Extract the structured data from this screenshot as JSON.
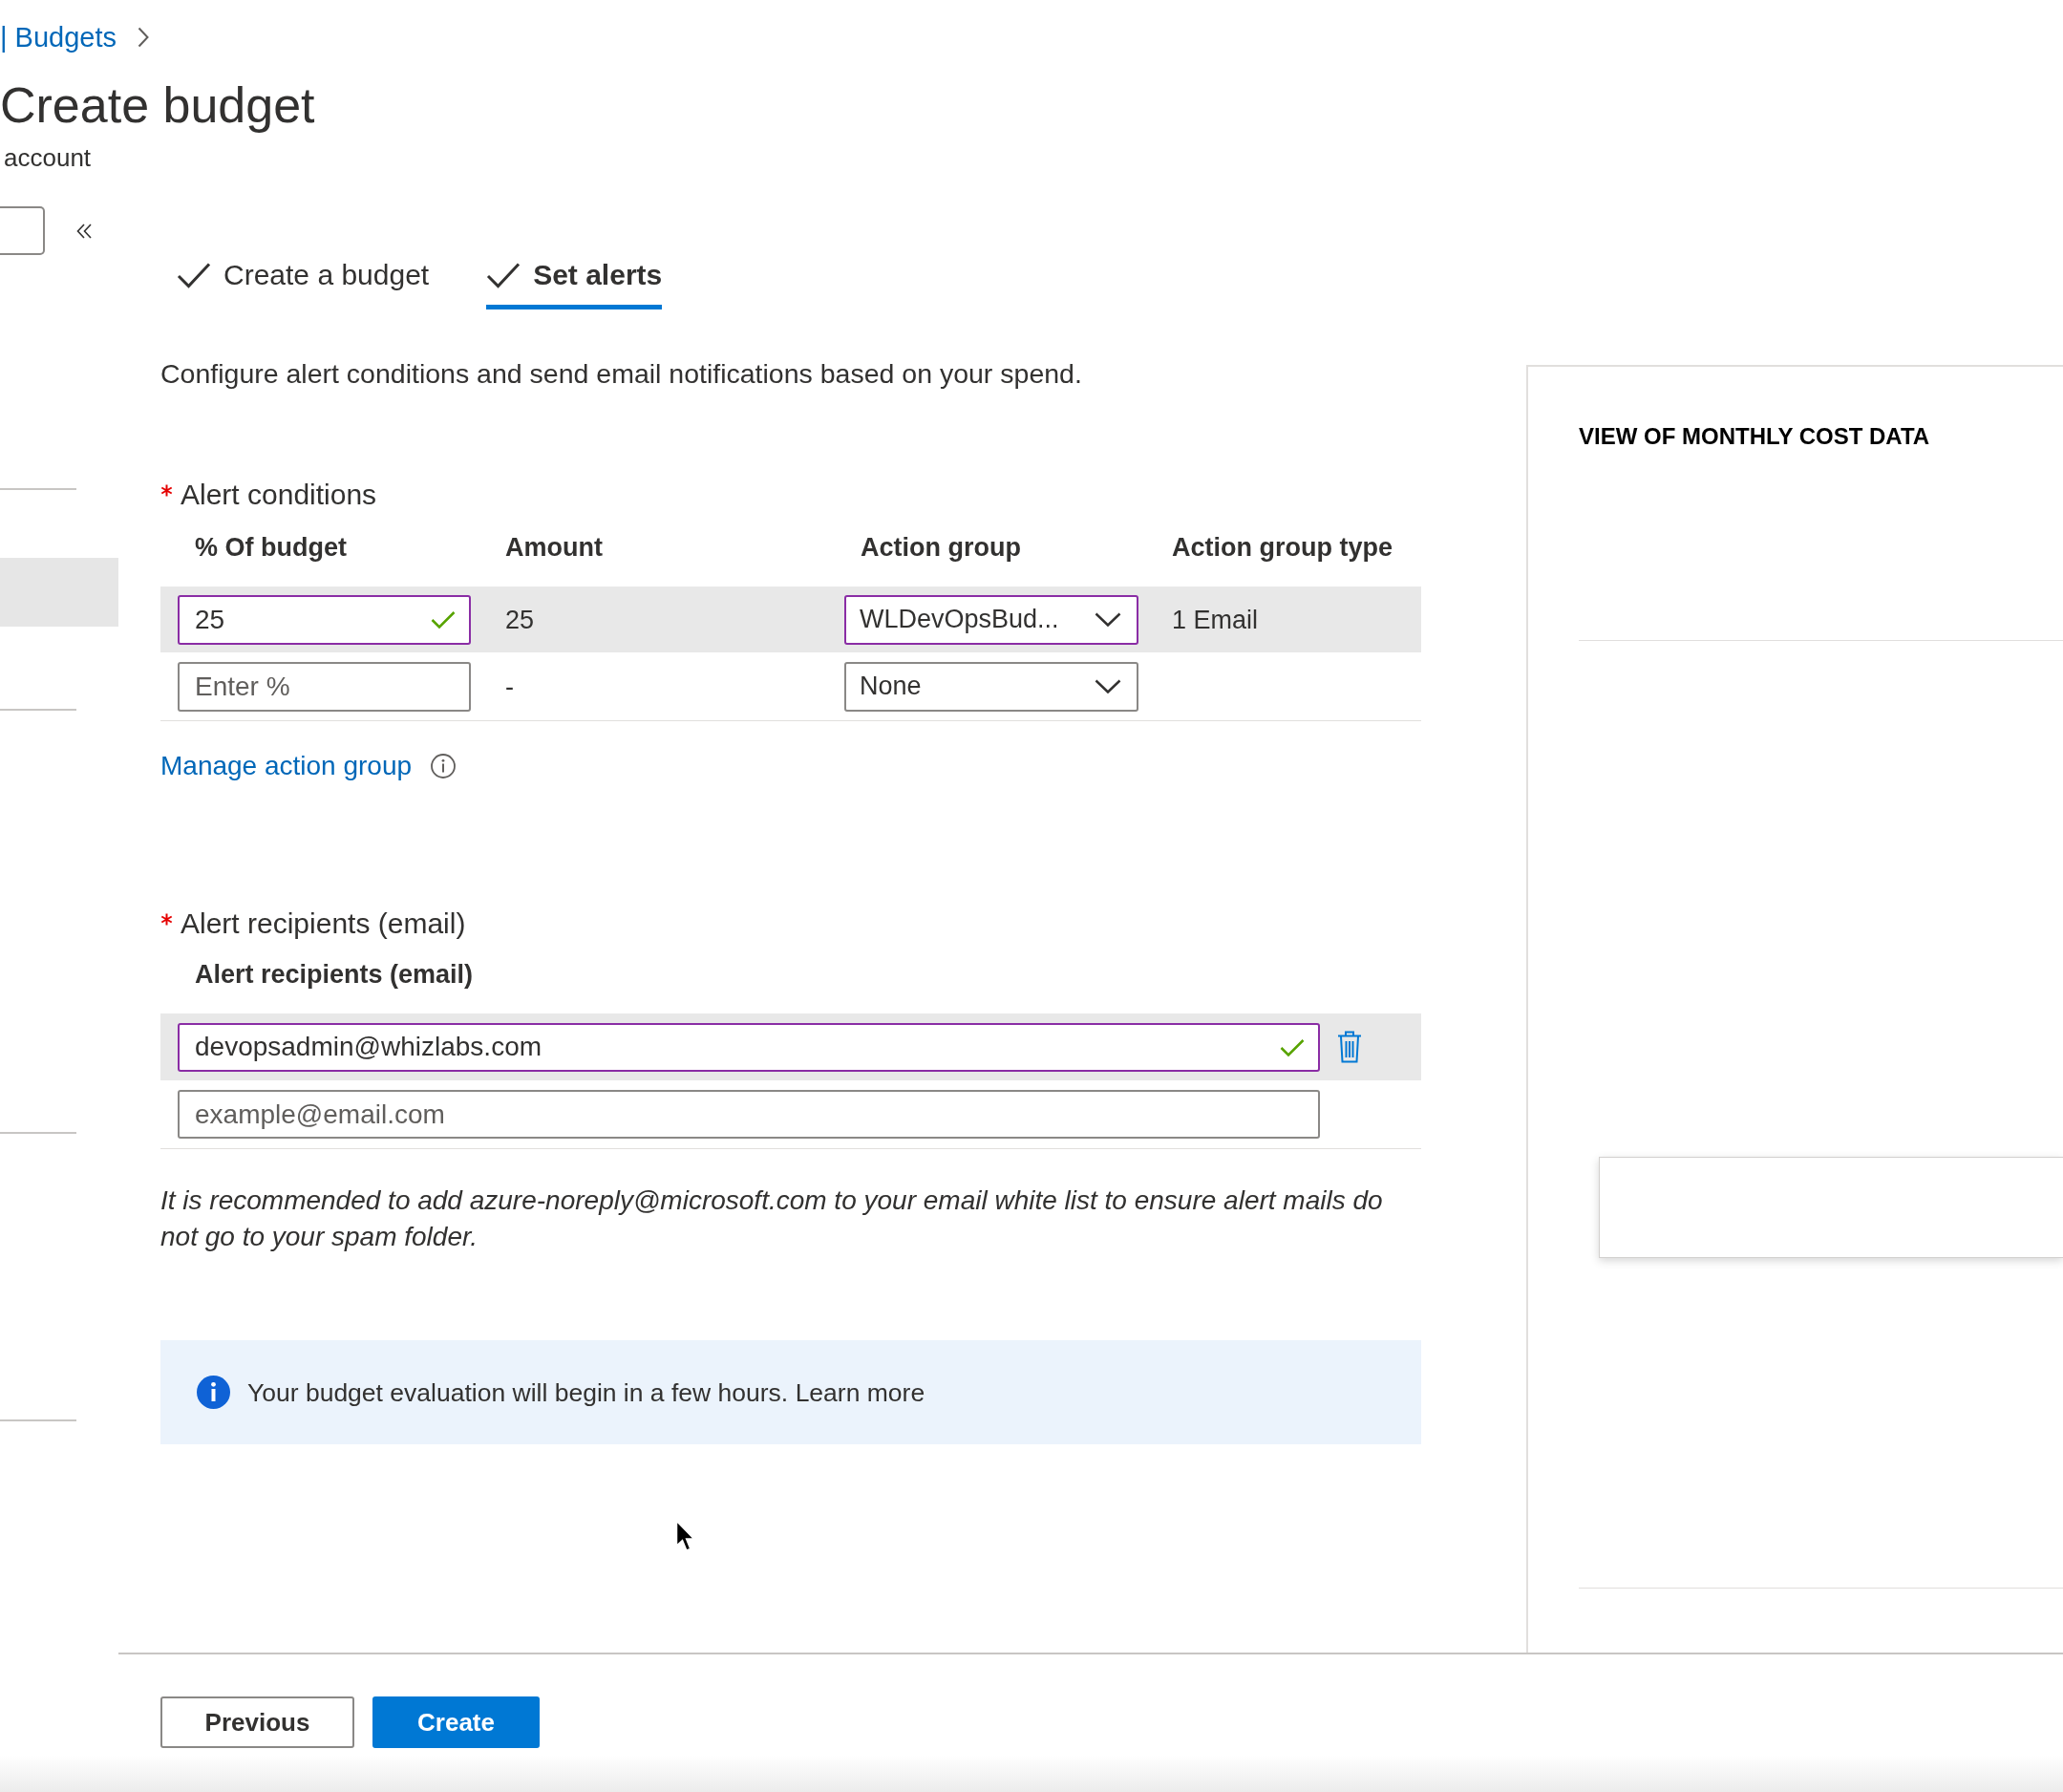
{
  "breadcrumb": {
    "label": "| Budgets"
  },
  "page": {
    "title": "Create budget",
    "subtitle": "account"
  },
  "sidebar": {
    "items": [
      {
        "selected": true
      }
    ]
  },
  "tabs": [
    {
      "label": "Create a budget",
      "done": true,
      "selected": false
    },
    {
      "label": "Set alerts",
      "done": true,
      "selected": true
    }
  ],
  "description": "Configure alert conditions and send email notifications based on your spend.",
  "alert_conditions": {
    "label": "Alert conditions",
    "required": true,
    "columns": [
      "% Of budget",
      "Amount",
      "Action group",
      "Action group type"
    ],
    "rows": [
      {
        "selected": true,
        "percent": {
          "value": "25",
          "validated": true
        },
        "amount": "25",
        "action_group": {
          "value": "WLDevOpsBud...",
          "validated": true
        },
        "action_group_type": "1 Email"
      },
      {
        "selected": false,
        "percent": {
          "placeholder": "Enter %",
          "validated": false
        },
        "amount": "-",
        "action_group": {
          "value": "None",
          "validated": false
        }
      }
    ]
  },
  "manage_link": "Manage action group",
  "alert_recipients": {
    "label": "Alert recipients (email)",
    "required": true,
    "column": "Alert recipients (email)",
    "rows": [
      {
        "selected": true,
        "value": "devopsadmin@whizlabs.com",
        "validated": true,
        "deletable": true
      },
      {
        "selected": false,
        "placeholder": "example@email.com",
        "validated": false,
        "deletable": false
      }
    ]
  },
  "note": "It is recommended to add azure-noreply@microsoft.com to your email white list to ensure alert mails do not go to your spam folder.",
  "info": {
    "text": "Your budget evaluation will begin in a few hours.",
    "link": "Learn more"
  },
  "cost_panel": {
    "title": "VIEW OF MONTHLY COST DATA"
  },
  "buttons": [
    {
      "label": "Previous",
      "kind": "secondary"
    },
    {
      "label": "Create",
      "kind": "primary"
    }
  ]
}
